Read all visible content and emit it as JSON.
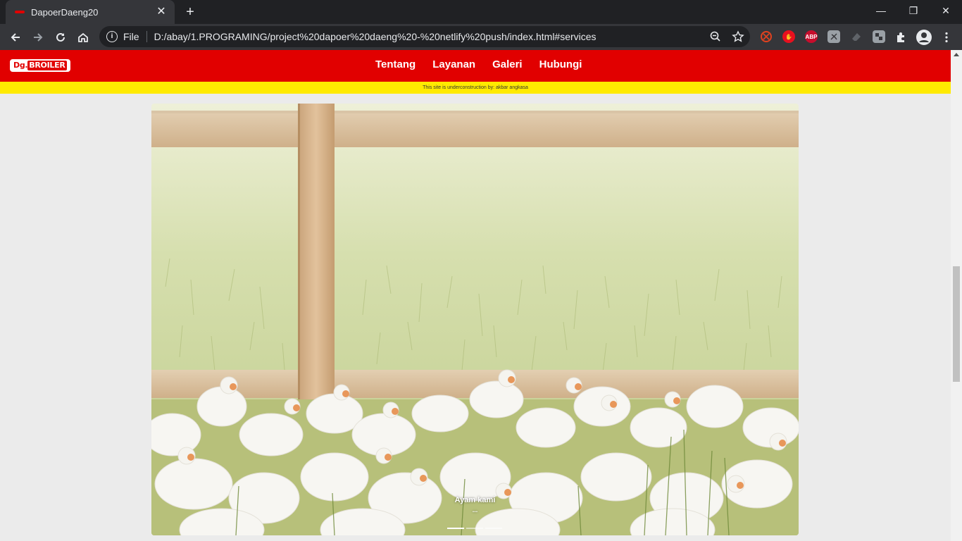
{
  "browser": {
    "tab_title": "DapoerDaeng20",
    "tab_close": "✕",
    "new_tab": "+",
    "window": {
      "minimize": "—",
      "maximize": "❐",
      "close": "✕"
    },
    "scheme_label": "File",
    "url": "D:/abay/1.PROGRAMING/project%20dapoer%20daeng%20-%20netlify%20push/index.html#services",
    "extensions": [
      {
        "icon": "ghostery-icon",
        "color": "#e1421f"
      },
      {
        "icon": "stop-hand-icon",
        "color": "#e8101e"
      },
      {
        "icon": "adblock-plus-icon",
        "label": "ABP",
        "color": "#c70d2c"
      },
      {
        "icon": "pdf-icon",
        "color": "#9aa0a6"
      },
      {
        "icon": "eraser-icon",
        "color": "#5f6368"
      },
      {
        "icon": "puzzle-tile-icon",
        "color": "#9aa0a6"
      }
    ]
  },
  "site": {
    "logo_prefix": "Dg.",
    "logo_text": "BROILER",
    "nav": [
      "Tentang",
      "Layanan",
      "Galeri",
      "Hubungi"
    ],
    "banner_text": "This site is underconstruction by: akbar angkasa",
    "carousel": {
      "caption_title": "Ayam kami",
      "caption_text": "...",
      "slides": 3,
      "active_slide": 1
    }
  },
  "colors": {
    "nav_red": "#e10000",
    "banner_yellow": "#ffea00",
    "page_bg": "#ebebeb"
  }
}
